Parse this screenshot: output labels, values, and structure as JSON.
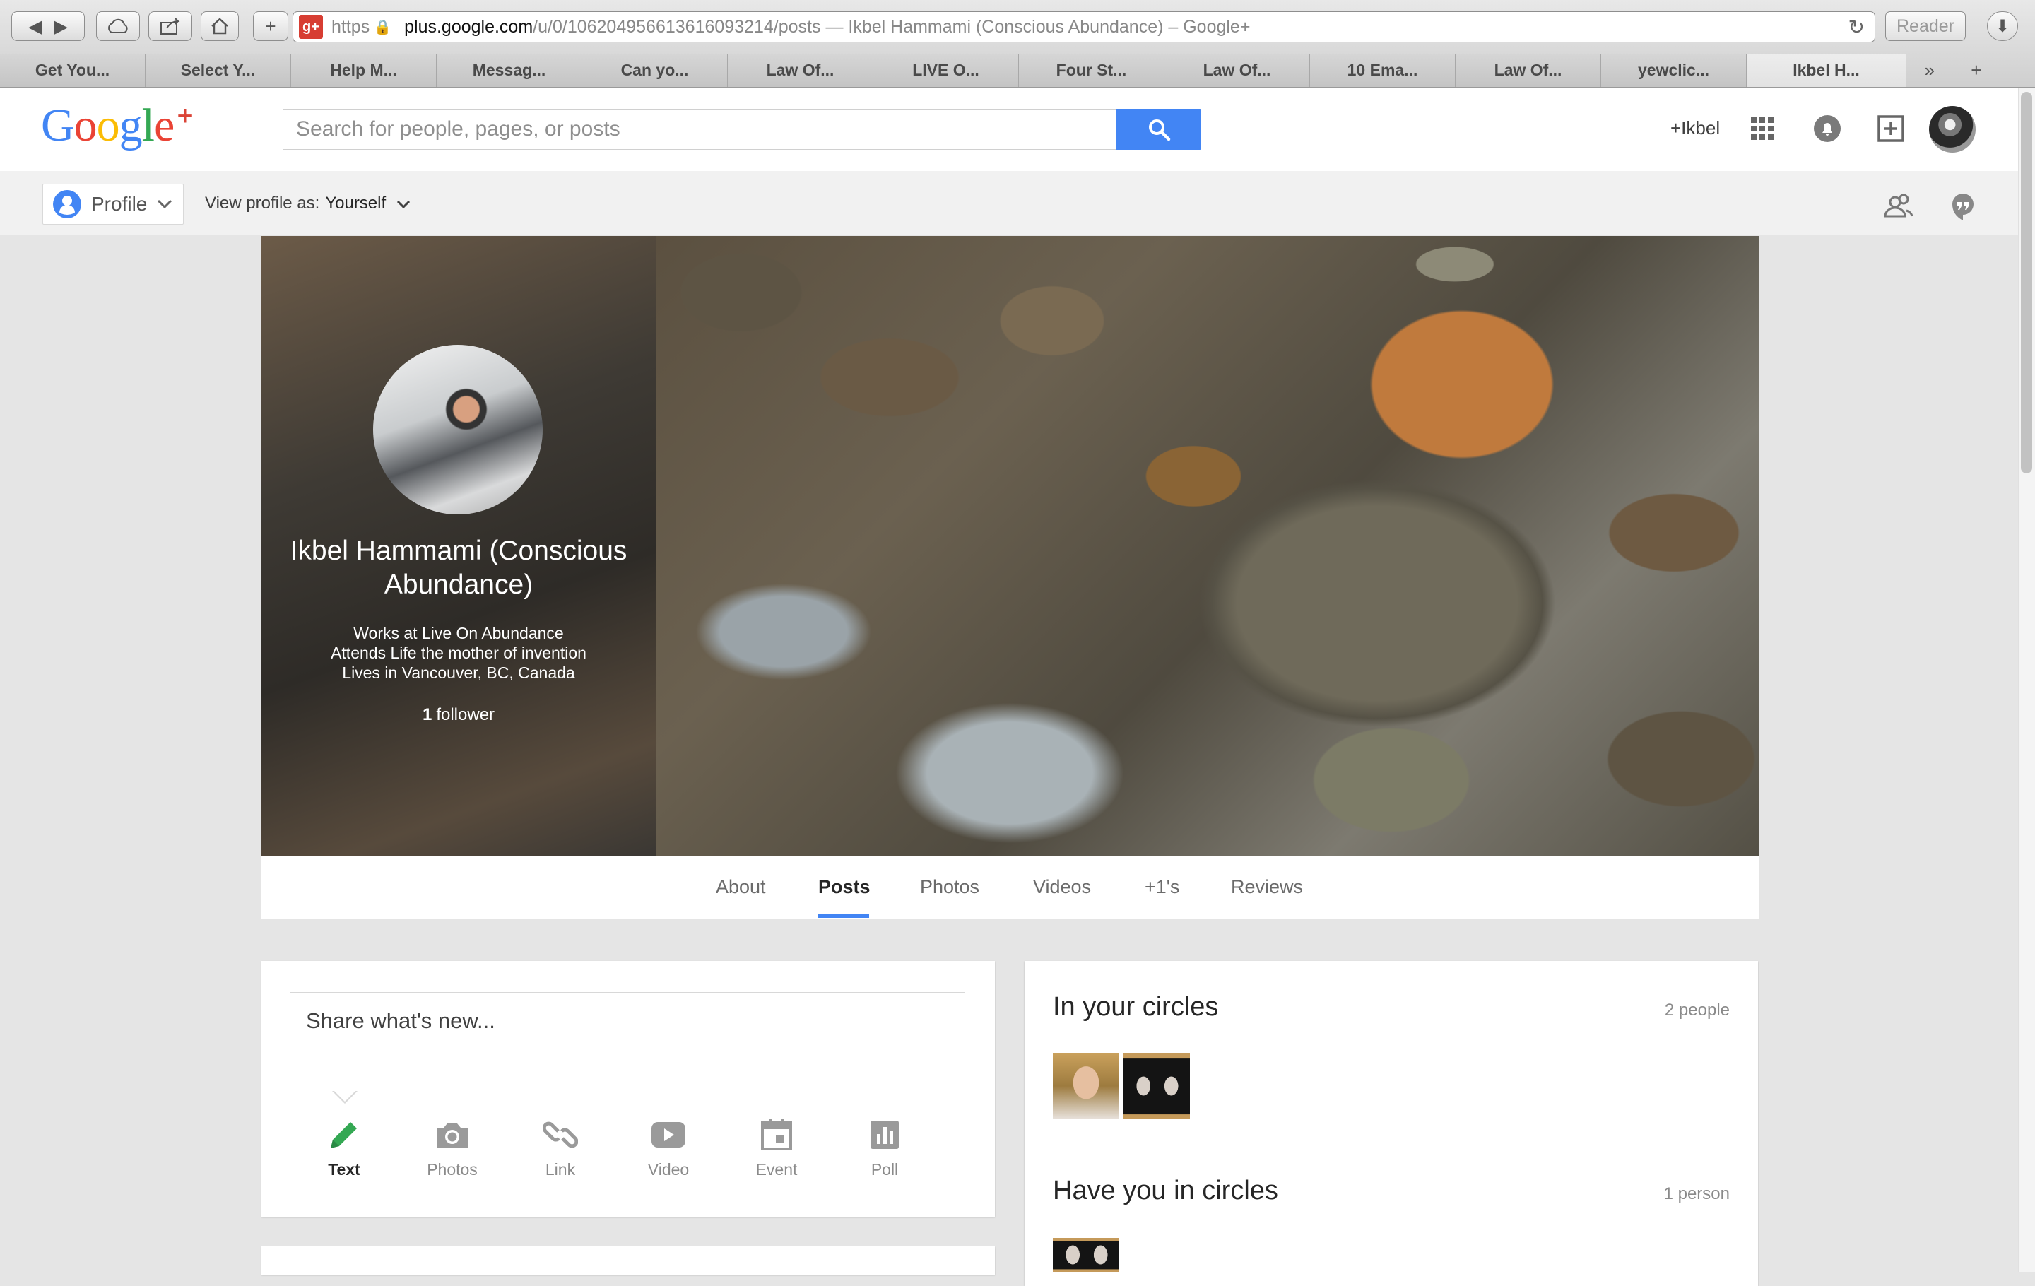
{
  "browser": {
    "url_scheme": "https",
    "url_host": "plus.google.com",
    "url_path": "/u/0/106204956613616093214/posts — Ikbel Hammami (Conscious Abundance) – Google+",
    "reader_label": "Reader",
    "favicon_label": "g+",
    "tabs": [
      {
        "label": "Get You..."
      },
      {
        "label": "Select Y..."
      },
      {
        "label": "Help M..."
      },
      {
        "label": "Messag..."
      },
      {
        "label": "Can yo..."
      },
      {
        "label": "Law Of..."
      },
      {
        "label": "LIVE O..."
      },
      {
        "label": "Four St..."
      },
      {
        "label": "Law Of..."
      },
      {
        "label": "10 Ema..."
      },
      {
        "label": "Law Of..."
      },
      {
        "label": "yewclic..."
      },
      {
        "label": "Ikbel H..."
      }
    ],
    "active_tab_index": 12
  },
  "header": {
    "logo": {
      "G": "G",
      "o1": "o",
      "o2": "o",
      "g": "g",
      "l": "l",
      "e": "e",
      "plus": "+"
    },
    "search_placeholder": "Search for people, pages, or posts",
    "user_link": "+Ikbel",
    "icons": [
      "apps-grid-icon",
      "notifications-bell-icon",
      "share-plus-icon",
      "account-avatar"
    ]
  },
  "subbar": {
    "profile_label": "Profile",
    "view_as_label": "View profile as:",
    "view_as_value": "Yourself"
  },
  "profile": {
    "name": "Ikbel Hammami (Conscious Abundance)",
    "works": "Works at Live On Abundance",
    "attends": "Attends Life the mother of invention",
    "lives": "Lives in Vancouver, BC, Canada",
    "follower_count": "1",
    "follower_label": "follower"
  },
  "tabs": {
    "about": "About",
    "posts": "Posts",
    "photos": "Photos",
    "videos": "Videos",
    "plusones": "+1's",
    "reviews": "Reviews",
    "active": "Posts"
  },
  "share": {
    "placeholder": "Share what's new...",
    "options": {
      "text": "Text",
      "photos": "Photos",
      "link": "Link",
      "video": "Video",
      "event": "Event",
      "poll": "Poll"
    }
  },
  "circles": {
    "in_your_circles_title": "In your circles",
    "in_your_circles_count": "2 people",
    "have_you_title": "Have you in circles",
    "have_you_count": "1 person"
  },
  "colors": {
    "accent_blue": "#4285f4",
    "google_blue": "#4285f4",
    "google_red": "#ea4335",
    "google_yellow": "#fbbc05",
    "google_green": "#34a853",
    "text_share_active": "#34a853"
  }
}
